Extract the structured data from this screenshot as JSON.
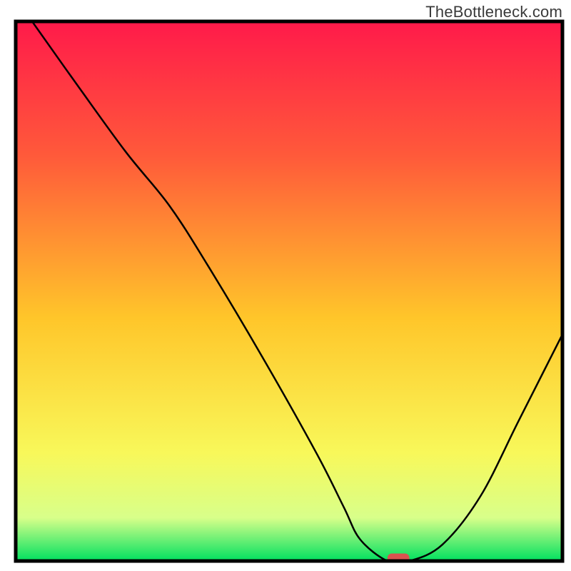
{
  "watermark": "TheBottleneck.com",
  "chart_data": {
    "type": "line",
    "title": "",
    "xlabel": "",
    "ylabel": "",
    "xlim": [
      0,
      100
    ],
    "ylim": [
      0,
      100
    ],
    "x": [
      3,
      10,
      20,
      28,
      35,
      45,
      55,
      60,
      63,
      68,
      72,
      78,
      85,
      92,
      100
    ],
    "values": [
      100,
      90,
      76,
      66,
      55,
      38,
      20,
      10,
      4,
      0,
      0,
      3,
      12,
      26,
      42
    ],
    "gradient_stops": [
      {
        "offset": 0.0,
        "color": "#ff1a4a"
      },
      {
        "offset": 0.25,
        "color": "#ff5a3a"
      },
      {
        "offset": 0.55,
        "color": "#ffc62a"
      },
      {
        "offset": 0.8,
        "color": "#f8f85a"
      },
      {
        "offset": 0.92,
        "color": "#d8ff8a"
      },
      {
        "offset": 1.0,
        "color": "#00e060"
      }
    ],
    "marker": {
      "x": 70,
      "y": 0,
      "color": "#d9534f",
      "width": 4,
      "height": 2
    },
    "frame_color": "#000000",
    "curve_color": "#000000"
  }
}
